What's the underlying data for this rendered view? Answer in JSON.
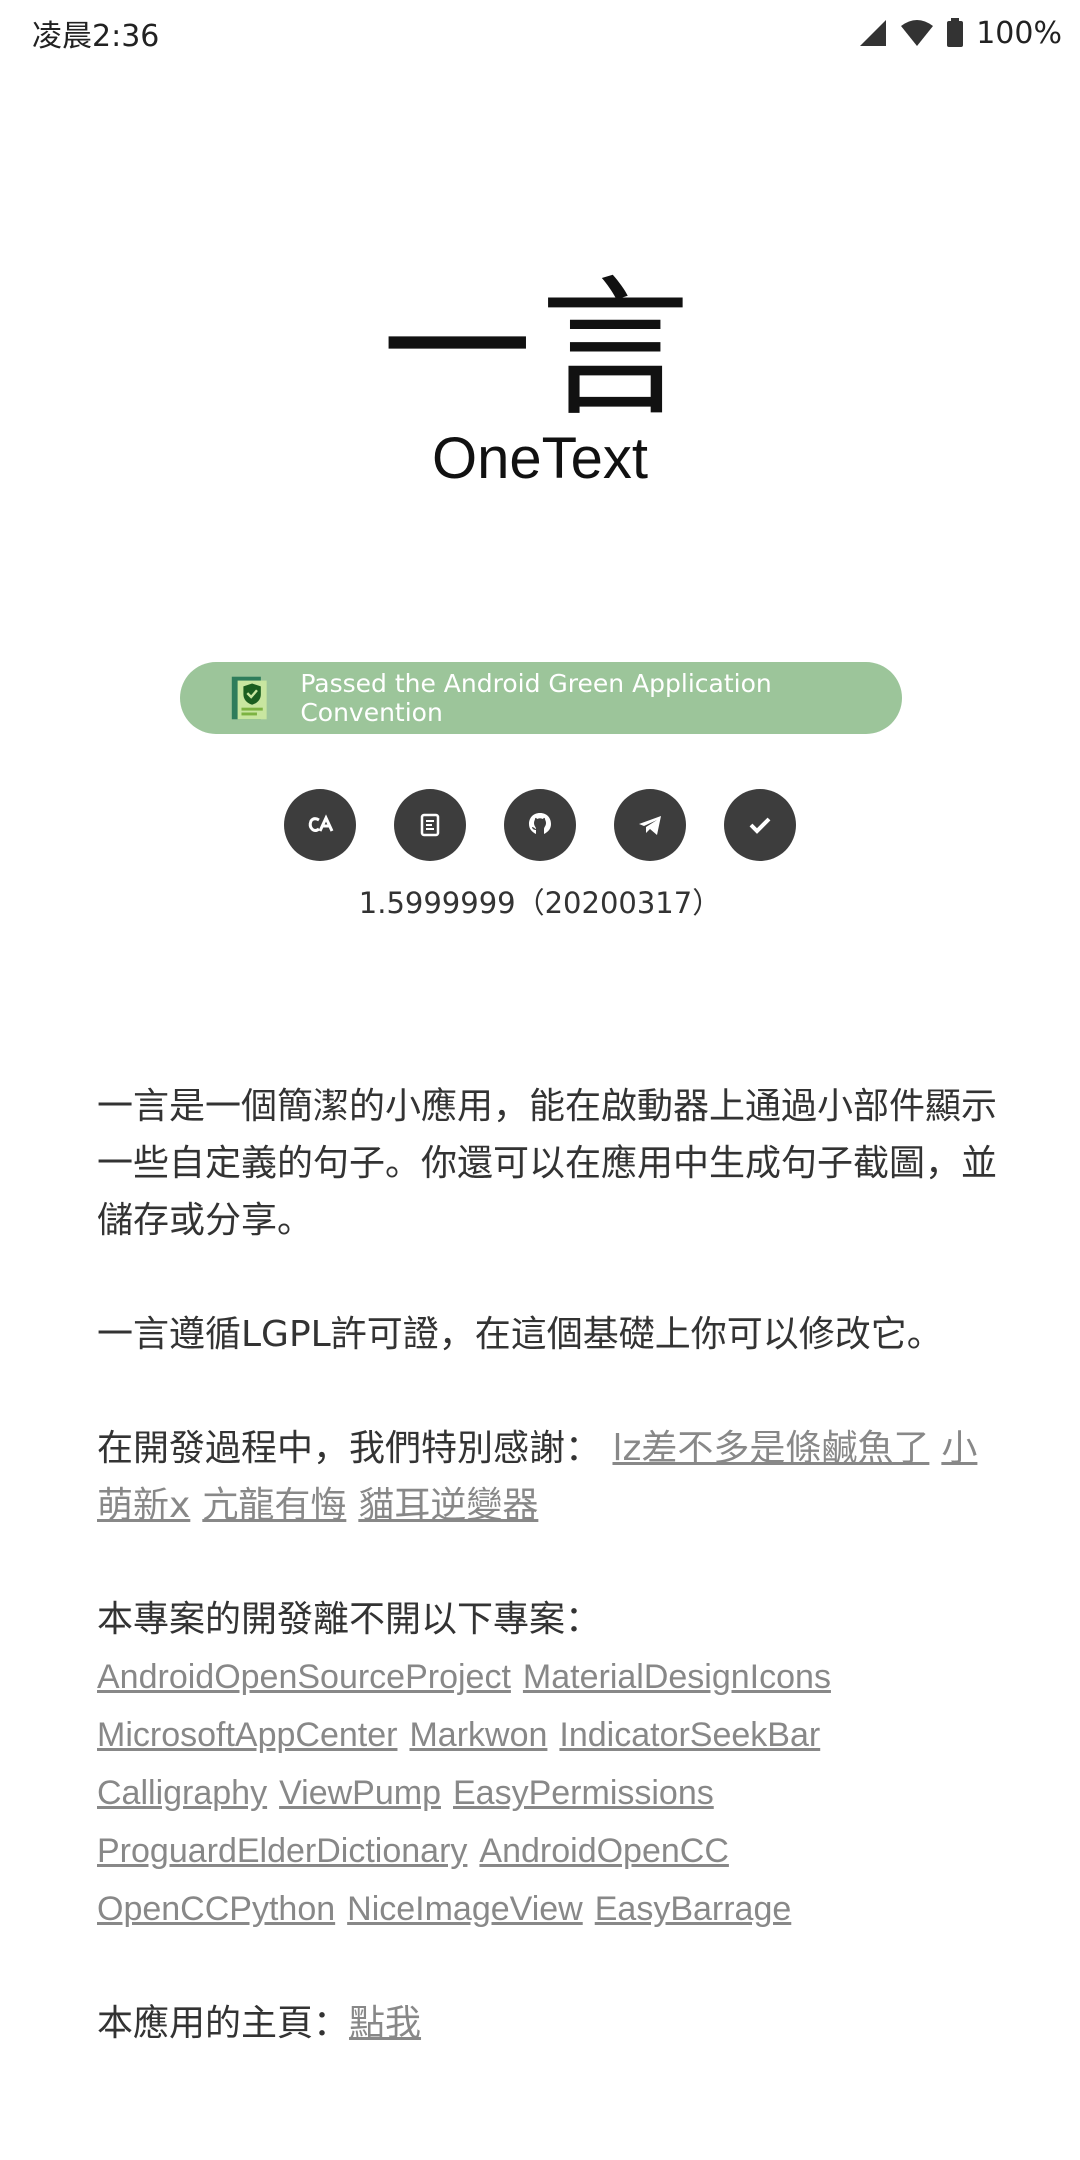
{
  "status": {
    "time": "凌晨2:36",
    "battery": "100%"
  },
  "logo": {
    "chinese": "一言",
    "english": "OneText"
  },
  "badge": {
    "text": "Passed the Android Green Application Convention"
  },
  "icons": [
    "creative-commons-icon",
    "coolapk-icon",
    "github-icon",
    "telegram-icon",
    "check-icon"
  ],
  "version": "1.5999999（20200317）",
  "about": {
    "intro": "一言是一個簡潔的小應用，能在啟動器上通過小部件顯示一些自定義的句子。你還可以在應用中生成句子截圖，並儲存或分享。",
    "license": "一言遵循LGPL許可證，在這個基礎上你可以修改它。",
    "thanks_label": "在開發過程中，我們特別感謝：",
    "thanks": [
      "lz差不多是條鹹魚了",
      "小萌新x",
      "亢龍有悔",
      "貓耳逆變器"
    ],
    "projects_label": "本專案的開發離不開以下專案：",
    "projects": [
      "AndroidOpenSourceProject",
      "MaterialDesignIcons",
      "MicrosoftAppCenter",
      "Markwon",
      "IndicatorSeekBar",
      "Calligraphy",
      "ViewPump",
      "EasyPermissions",
      "ProguardElderDictionary",
      "AndroidOpenCC",
      "OpenCCPython",
      "NiceImageView",
      "EasyBarrage"
    ],
    "homepage_label": "本應用的主頁：",
    "homepage_link": "點我"
  },
  "colors": {
    "badge": "#9cc59a",
    "icon_circle": "#3d3d3d",
    "link": "#888888"
  }
}
